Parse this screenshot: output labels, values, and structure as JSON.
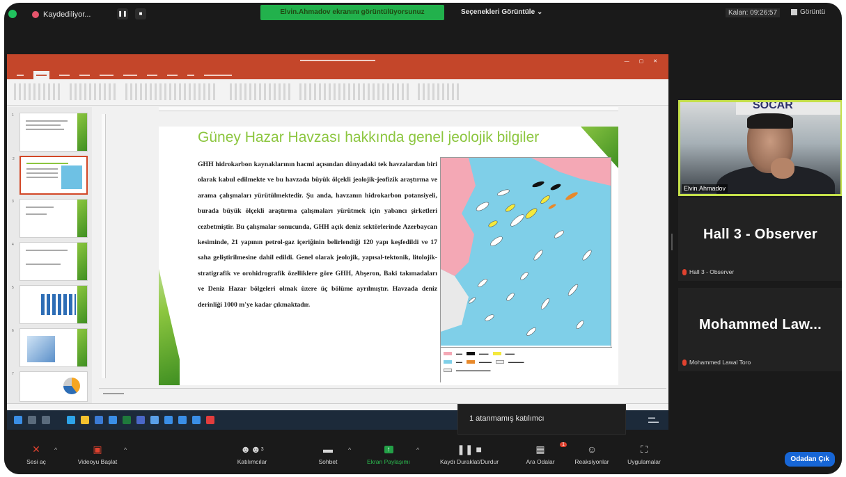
{
  "topbar": {
    "recording_label": "Kaydediliyor...",
    "share_banner": "Elvin.Ahmadov ekranını görüntülüyorsunuz",
    "view_options": "Seçenekleri Görüntüle",
    "remaining": "Kalan: 09:26:57",
    "view_button": "Görüntü"
  },
  "slide": {
    "title": "Güney Hazar Havzası hakkında genel jeolojik bilgiler",
    "body": "GHH hidrokarbon kaynaklarının hacmi açısından dünyadaki tek havzalardan biri olarak kabul edilmekte ve bu havzada büyük ölçekli jeolojik-jeofizik araştırma ve arama çalışmaları yürütülmektedir. Şu anda, havzanın hidrokarbon potansiyeli, burada büyük ölçekli araştırma çalışmaları yürütmek için yabancı şirketleri cezbetmiştir. Bu çalışmalar sonucunda, GHH açık deniz sektörlerinde Azerbaycan kesiminde, 21 yapının petrol-gaz içeriğinin belirlendiği 120 yapı keşfedildi ve 17 saha geliştirilmesine dahil edildi. Genel olarak jeolojik, yapısal-tektonik, litolojik-stratigrafik ve orohidrografik özelliklere göre GHH, Abşeron, Baki takımadaları ve Deniz Hazar bölgeleri olmak üzere üç bölüme ayrılmıştır. Havzada deniz derinliği 1000 m'ye kadar çıkmaktadır."
  },
  "tooltip": "1 atanmamış katılımcı",
  "participants": [
    {
      "type": "video",
      "name": "Elvin.Ahmadov",
      "sign": "SOCAR"
    },
    {
      "type": "name",
      "display": "Hall 3 - Observer",
      "label": "Hall 3 - Observer"
    },
    {
      "type": "name",
      "display": "Mohammed  Law...",
      "label": "Mohammed Lawal Toro"
    }
  ],
  "toolbar": {
    "items": [
      {
        "icon": "mic-muted-icon",
        "label": "Sesi aç"
      },
      {
        "icon": "video-off-icon",
        "label": "Videoyu Başlat"
      },
      {
        "icon": "participants-icon",
        "label": "Katılımcılar",
        "count": "3"
      },
      {
        "icon": "chat-icon",
        "label": "Sohbet"
      },
      {
        "icon": "share-screen-icon",
        "label": "Ekran Paylaşımı"
      },
      {
        "icon": "record-pause-icon",
        "label": "Kaydı Duraklat/Durdur"
      },
      {
        "icon": "breakout-rooms-icon",
        "label": "Ara Odalar"
      },
      {
        "icon": "reactions-icon",
        "label": "Reaksiyonlar"
      },
      {
        "icon": "apps-icon",
        "label": "Uygulamalar"
      }
    ],
    "leave": "Odadan Çık"
  },
  "colors": {
    "share_banner": "#22b14c",
    "slide_accent": "#8cc63f",
    "ppt_header": "#c4462a",
    "leave": "#1766d6",
    "active_speaker": "#c5e04a"
  }
}
